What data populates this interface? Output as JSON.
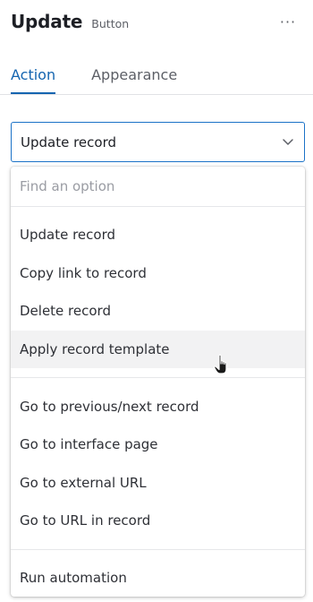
{
  "header": {
    "title": "Update",
    "subtitle": "Button",
    "more_label": "···"
  },
  "tabs": [
    {
      "label": "Action",
      "active": true
    },
    {
      "label": "Appearance",
      "active": false
    }
  ],
  "select": {
    "value": "Update record"
  },
  "dropdown": {
    "search_placeholder": "Find an option",
    "groups": [
      [
        "Update record",
        "Copy link to record",
        "Delete record",
        "Apply record template"
      ],
      [
        "Go to previous/next record",
        "Go to interface page",
        "Go to external URL",
        "Go to URL in record"
      ],
      [
        "Run automation"
      ]
    ],
    "hovered_item": "Apply record template"
  },
  "colors": {
    "accent": "#1565b0",
    "border_focus": "#1b72c7",
    "hover_bg": "#f2f2f3"
  }
}
